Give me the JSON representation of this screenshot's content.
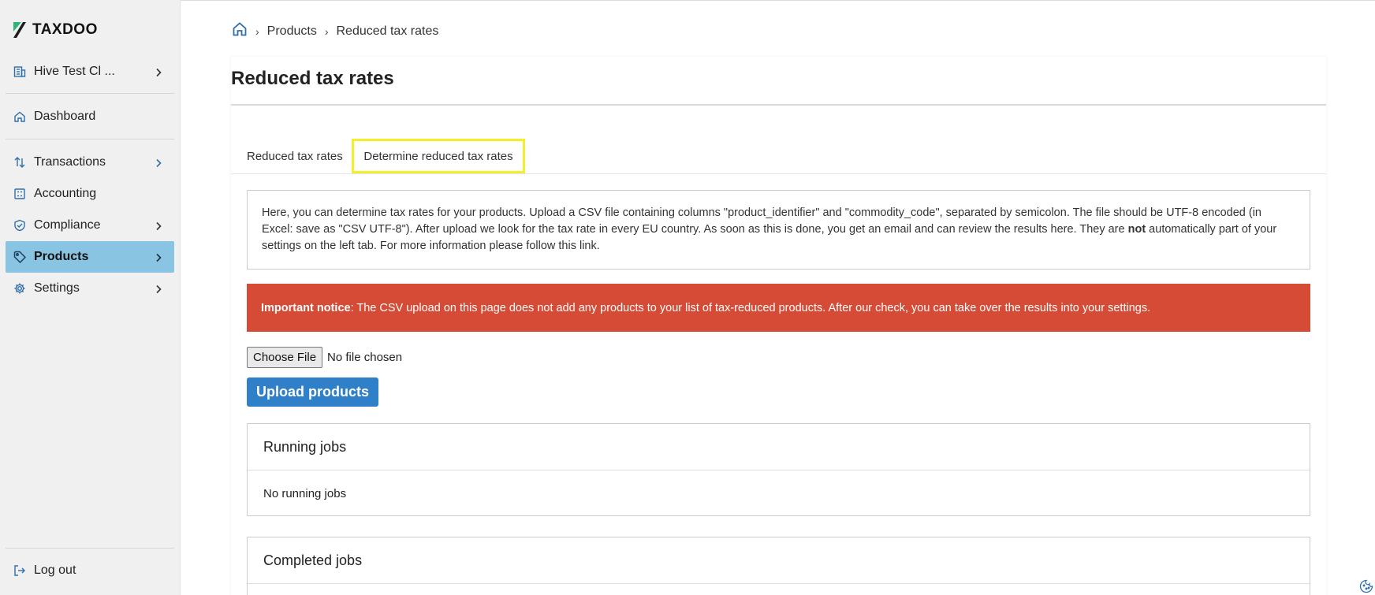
{
  "sidebar": {
    "brand": "TAXDOO",
    "company": "Hive Test Cl ...",
    "items": [
      {
        "label": "Dashboard",
        "icon": "home-icon"
      },
      {
        "label": "Transactions",
        "icon": "arrows-icon"
      },
      {
        "label": "Accounting",
        "icon": "calculator-icon"
      },
      {
        "label": "Compliance",
        "icon": "shield-check-icon"
      },
      {
        "label": "Products",
        "icon": "tag-icon"
      },
      {
        "label": "Settings",
        "icon": "gear-icon"
      }
    ],
    "logout": "Log out",
    "active": "Products",
    "active_color": "#89c4e3"
  },
  "breadcrumb": {
    "items": [
      "Products",
      "Reduced tax rates"
    ]
  },
  "page": {
    "title": "Reduced tax rates"
  },
  "tabs": [
    {
      "label": "Reduced tax rates"
    },
    {
      "label": "Determine reduced tax rates",
      "highlighted": true
    }
  ],
  "info": {
    "text_before": "Here, you can determine tax rates for your products. Upload a CSV file containing columns \"product_identifier\" and \"commodity_code\", separated by semicolon. The file should be UTF-8 encoded (in Excel: save as \"CSV UTF-8\"). After upload we look for the tax rate in every EU country. As soon as this is done, you get an email and can review the results here. They are ",
    "bold": "not",
    "text_after": " automatically part of your settings on the left tab. For more information please follow this link."
  },
  "notice": {
    "title": "Important notice",
    "text": ": The CSV upload on this page does not add any products to your list of tax-reduced products. After our check, you can take over the results into your settings.",
    "color": "#d64b36"
  },
  "file_input": {
    "button": "Choose File",
    "status": "No file chosen"
  },
  "upload_button": "Upload products",
  "running_jobs": {
    "title": "Running jobs",
    "empty": "No running jobs"
  },
  "completed_jobs": {
    "title": "Completed jobs"
  },
  "colors": {
    "primary": "#2f80c9",
    "tab_highlight": "#f5ef2a"
  }
}
